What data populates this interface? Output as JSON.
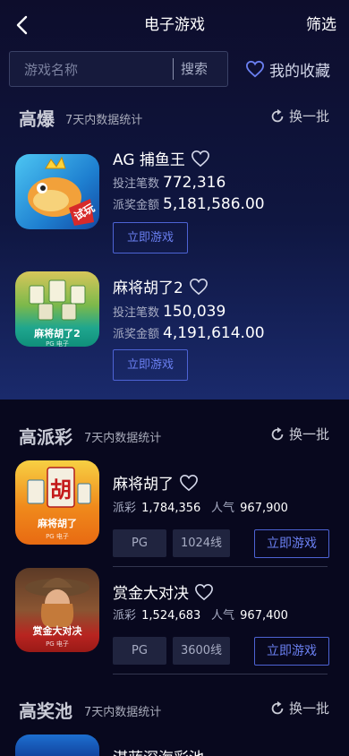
{
  "header": {
    "title": "电子游戏",
    "filter_label": "筛选"
  },
  "search": {
    "placeholder": "游戏名称",
    "button_label": "搜索"
  },
  "favorites": {
    "label": "我的收藏"
  },
  "sections": {
    "high_burst": {
      "title": "高爆",
      "subtitle": "7天内数据统计",
      "refresh_label": "换一批",
      "games": [
        {
          "name": "AG 捕鱼王",
          "bet_label": "投注笔数",
          "bet_value": "772,316",
          "payout_label": "派奖金额",
          "payout_value": "5,181,586.00",
          "play_label": "立即游戏",
          "thumb_badge": "试玩"
        },
        {
          "name": "麻将胡了2",
          "bet_label": "投注笔数",
          "bet_value": "150,039",
          "payout_label": "派奖金额",
          "payout_value": "4,191,614.00",
          "play_label": "立即游戏",
          "thumb_title": "麻将胡了2",
          "thumb_sub": "PG 电子"
        }
      ]
    },
    "high_payout": {
      "title": "高派彩",
      "subtitle": "7天内数据统计",
      "refresh_label": "换一批",
      "games": [
        {
          "name": "麻将胡了",
          "payout_label": "派彩",
          "payout_value": "1,784,356",
          "pop_label": "人气",
          "pop_value": "967,900",
          "provider": "PG",
          "lines": "1024线",
          "play_label": "立即游戏",
          "thumb_title": "麻将胡了",
          "thumb_sub": "PG 电子",
          "thumb_glyph": "胡"
        },
        {
          "name": "赏金大对决",
          "payout_label": "派彩",
          "payout_value": "1,524,683",
          "pop_label": "人气",
          "pop_value": "967,400",
          "provider": "PG",
          "lines": "3600线",
          "play_label": "立即游戏",
          "thumb_title": "赏金大对决",
          "thumb_sub": "PG 电子"
        }
      ]
    },
    "jackpot": {
      "title": "高奖池",
      "subtitle": "7天内数据统计",
      "refresh_label": "换一批",
      "games": [
        {
          "name": "湛蓝深海彩池"
        }
      ]
    }
  },
  "icons": {
    "back": "chevron-left-icon",
    "favorite": "heart-outline-icon",
    "refresh": "refresh-icon"
  },
  "colors": {
    "background": "#08081e",
    "accent_blue": "#6a7ff0",
    "section_title": "#c9cbd6"
  }
}
